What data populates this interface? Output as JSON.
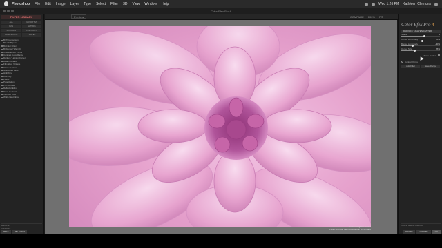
{
  "menubar": {
    "app_name": "Photoshop",
    "menus": [
      "File",
      "Edit",
      "Image",
      "Layer",
      "Type",
      "Select",
      "Filter",
      "3D",
      "View",
      "Window",
      "Help"
    ],
    "clock": "Wed 1:26 PM",
    "user": "Kathleen Clemons"
  },
  "window": {
    "title": "Color Efex Pro 4"
  },
  "toolbar": {
    "preview_label": "Preview",
    "right_labels": [
      "COMPARE",
      "100%",
      "FIT"
    ]
  },
  "left_panel": {
    "library_title": "FILTER LIBRARY",
    "filter_categories": [
      "ALL",
      "FAVORITES",
      "B/W",
      "NATURE",
      "MODERN",
      "PORTRAIT",
      "LANDSCAPE",
      "TRAVEL"
    ],
    "presets": [
      "B/W Conversion",
      "Bleach Bypass",
      "Bi-Color Filters",
      "Brilliance / Warmth",
      "Classical Soft Focus",
      "Contrast Color Range",
      "Darken / Lighten Center",
      "Detail Extractor",
      "Film Efex: Vintage",
      "Glamour Glow",
      "Graduated Filters",
      "High Key",
      "Low Key",
      "Pastel",
      "Polarization",
      "Pro Contrast",
      "Reflector Efex",
      "Tonal Contrast",
      "Vignette Filter",
      "White Neutralizer"
    ],
    "recipes_label": "RECIPES",
    "history_label": "HISTORY",
    "bottom_buttons": [
      "HELP",
      "SETTINGS"
    ]
  },
  "main": {
    "photo_caption_line1": "Darken / Lighten Center",
    "photo_caption_line2": "Press and hold the mouse button to compare"
  },
  "right_panel": {
    "product_name": "Color Efex Pro",
    "product_version": "4",
    "filter_name": "DARKEN / LIGHTEN CENTER",
    "sliders": [
      {
        "label": "Shape",
        "value": "1",
        "fraction": 0.6
      },
      {
        "label": "Center Luminosity",
        "value": "10%",
        "fraction": 0.55
      },
      {
        "label": "Border Luminosity",
        "value": "-40%",
        "fraction": 0.3
      },
      {
        "label": "Center Size",
        "value": "35%",
        "fraction": 0.35
      }
    ],
    "place_center_label": "Place Center",
    "control_points_label": "Control Points",
    "control_point_buttons": [
      "Add Filter",
      "Save Recipe"
    ],
    "loupe_label": "LOUPE & HISTOGRAM",
    "bottom_buttons": [
      "BRUSH",
      "CANCEL",
      "OK"
    ]
  }
}
